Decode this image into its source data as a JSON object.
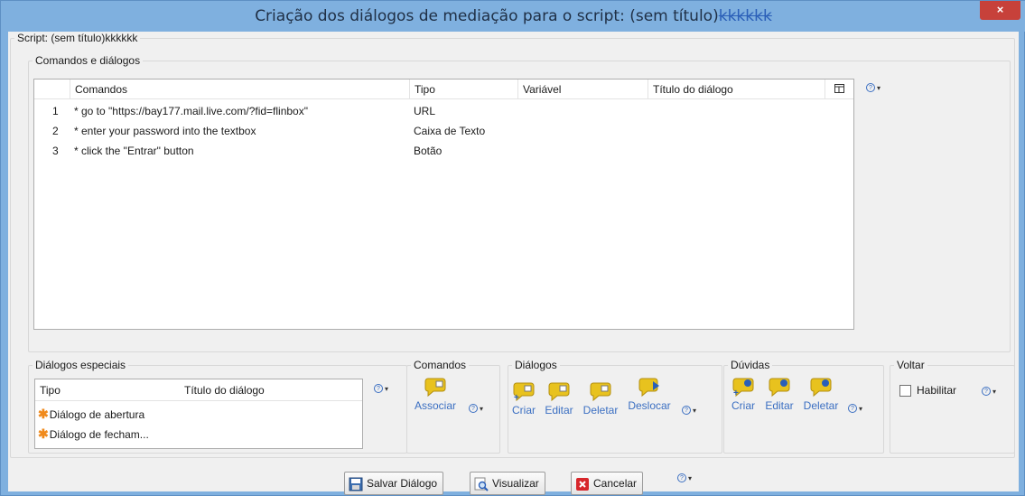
{
  "window": {
    "title": "Criação dos diálogos de mediação para o script: (sem título)",
    "title_strike": "kkkkkk",
    "close_glyph": "×"
  },
  "script_group": {
    "legend": "Script: (sem título)kkkkkk"
  },
  "commands_group": {
    "legend": "Comandos e diálogos",
    "columns": [
      "Comandos",
      "Tipo",
      "Variável",
      "Título do diálogo"
    ],
    "rows": [
      {
        "num": "1",
        "command": "* go to \"https://bay177.mail.live.com/?fid=flinbox\"",
        "type": "URL",
        "variable": "",
        "title": ""
      },
      {
        "num": "2",
        "command": "* enter your password into the textbox",
        "type": "Caixa de Texto",
        "variable": "",
        "title": ""
      },
      {
        "num": "3",
        "command": "* click the \"Entrar\" button",
        "type": "Botão",
        "variable": "",
        "title": ""
      }
    ]
  },
  "special_dialogs": {
    "legend": "Diálogos especiais",
    "columns": [
      "Tipo",
      "Título do diálogo"
    ],
    "rows": [
      {
        "type": "Diálogo de abertura",
        "title": ""
      },
      {
        "type": "Diálogo de fecham...",
        "title": ""
      }
    ]
  },
  "commands_toolbar": {
    "legend": "Comandos",
    "associate_label": "Associar"
  },
  "dialogs_toolbar": {
    "legend": "Diálogos",
    "create_label": "Criar",
    "edit_label": "Editar",
    "delete_label": "Deletar",
    "move_label": "Deslocar"
  },
  "doubts_toolbar": {
    "legend": "Dúvidas",
    "create_label": "Criar",
    "edit_label": "Editar",
    "delete_label": "Deletar"
  },
  "back_group": {
    "legend": "Voltar",
    "enable_label": "Habilitar",
    "enabled": false
  },
  "footer": {
    "save_label": "Salvar Diálogo",
    "preview_label": "Visualizar",
    "cancel_label": "Cancelar"
  },
  "icons": {
    "help": "help-icon",
    "toolbar": "speech-bubble-icon",
    "star": "orange-star-icon",
    "save": "floppy-icon",
    "preview": "magnifier-icon",
    "cancel": "red-x-icon"
  },
  "colors": {
    "title_bar": "#7fb0df",
    "close_button": "#c7413a",
    "panel": "#f0f0f0",
    "link_blue": "#3b6fc2",
    "bubble_yellow": "#e8c21e",
    "star_orange": "#f08a1c"
  }
}
